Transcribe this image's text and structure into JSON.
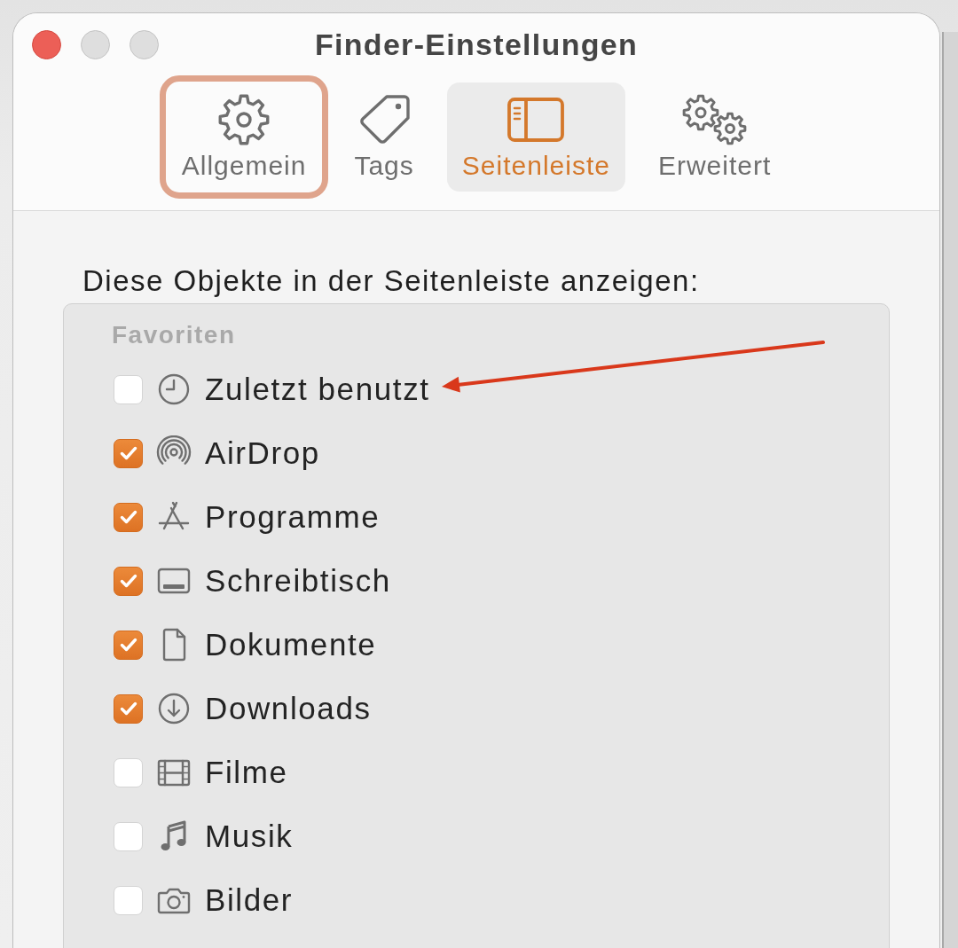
{
  "window": {
    "title": "Finder-Einstellungen"
  },
  "tabs": [
    {
      "label": "Allgemein",
      "selected": false,
      "annotation_frame": true
    },
    {
      "label": "Tags",
      "selected": false,
      "annotation_frame": false
    },
    {
      "label": "Seitenleiste",
      "selected": true,
      "annotation_frame": false
    },
    {
      "label": "Erweitert",
      "selected": false,
      "annotation_frame": false
    }
  ],
  "content": {
    "heading": "Diese Objekte in der Seitenleiste anzeigen:",
    "section": {
      "title": "Favoriten",
      "items": [
        {
          "label": "Zuletzt benutzt",
          "checked": false,
          "arrow": true
        },
        {
          "label": "AirDrop",
          "checked": true,
          "arrow": false
        },
        {
          "label": "Programme",
          "checked": true,
          "arrow": false
        },
        {
          "label": "Schreibtisch",
          "checked": true,
          "arrow": false
        },
        {
          "label": "Dokumente",
          "checked": true,
          "arrow": false
        },
        {
          "label": "Downloads",
          "checked": true,
          "arrow": false
        },
        {
          "label": "Filme",
          "checked": false,
          "arrow": false
        },
        {
          "label": "Musik",
          "checked": false,
          "arrow": false
        },
        {
          "label": "Bilder",
          "checked": false,
          "arrow": false
        }
      ]
    }
  }
}
